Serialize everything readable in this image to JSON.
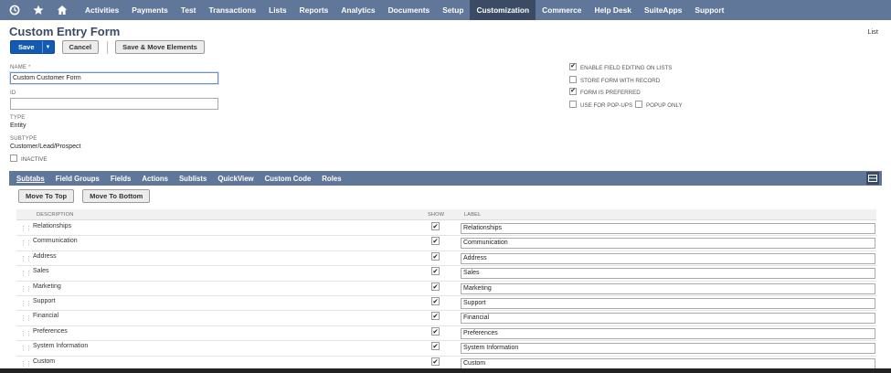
{
  "nav": {
    "icons": [
      "recent-icon",
      "star-icon",
      "home-icon"
    ],
    "items": [
      "Activities",
      "Payments",
      "Test",
      "Transactions",
      "Lists",
      "Reports",
      "Analytics",
      "Documents",
      "Setup",
      "Customization",
      "Commerce",
      "Help Desk",
      "SuiteApps",
      "Support"
    ],
    "active": "Customization"
  },
  "header": {
    "title": "Custom Entry Form",
    "list_link": "List"
  },
  "actions": {
    "save": "Save",
    "cancel": "Cancel",
    "save_move": "Save & Move Elements"
  },
  "fields": {
    "name_label": "NAME",
    "name_required": "*",
    "name_value": "Custom Customer Form",
    "id_label": "ID",
    "id_value": "",
    "type_label": "TYPE",
    "type_value": "Entity",
    "subtype_label": "SUBTYPE",
    "subtype_value": "Customer/Lead/Prospect",
    "inactive_label": "INACTIVE",
    "inactive_checked": false
  },
  "options": {
    "enable_field_editing": {
      "label": "ENABLE FIELD EDITING ON LISTS",
      "checked": true
    },
    "store_form": {
      "label": "STORE FORM WITH RECORD",
      "checked": false
    },
    "form_preferred": {
      "label": "FORM IS PREFERRED",
      "checked": true
    },
    "use_popups": {
      "label": "USE FOR POP-UPS",
      "checked": false
    },
    "popup_only": {
      "label": "POPUP ONLY",
      "checked": false
    }
  },
  "subtabs": [
    "Subtabs",
    "Field Groups",
    "Fields",
    "Actions",
    "Sublists",
    "QuickView",
    "Custom Code",
    "Roles"
  ],
  "subtab_active": "Subtabs",
  "sub_actions": {
    "move_top": "Move To Top",
    "move_bottom": "Move To Bottom"
  },
  "table": {
    "headers": {
      "description": "DESCRIPTION",
      "show": "SHOW",
      "label": "LABEL"
    },
    "rows": [
      {
        "description": "Relationships",
        "show": true,
        "label": "Relationships"
      },
      {
        "description": "Communication",
        "show": true,
        "label": "Communication"
      },
      {
        "description": "Address",
        "show": true,
        "label": "Address"
      },
      {
        "description": "Sales",
        "show": true,
        "label": "Sales"
      },
      {
        "description": "Marketing",
        "show": true,
        "label": "Marketing"
      },
      {
        "description": "Support",
        "show": true,
        "label": "Support"
      },
      {
        "description": "Financial",
        "show": true,
        "label": "Financial"
      },
      {
        "description": "Preferences",
        "show": true,
        "label": "Preferences"
      },
      {
        "description": "System Information",
        "show": true,
        "label": "System Information"
      },
      {
        "description": "Custom",
        "show": true,
        "label": "Custom"
      }
    ]
  },
  "colors": {
    "nav_bg": "#607799",
    "nav_active": "#3b4b63",
    "primary": "#125ab2",
    "title": "#3b4b63"
  }
}
